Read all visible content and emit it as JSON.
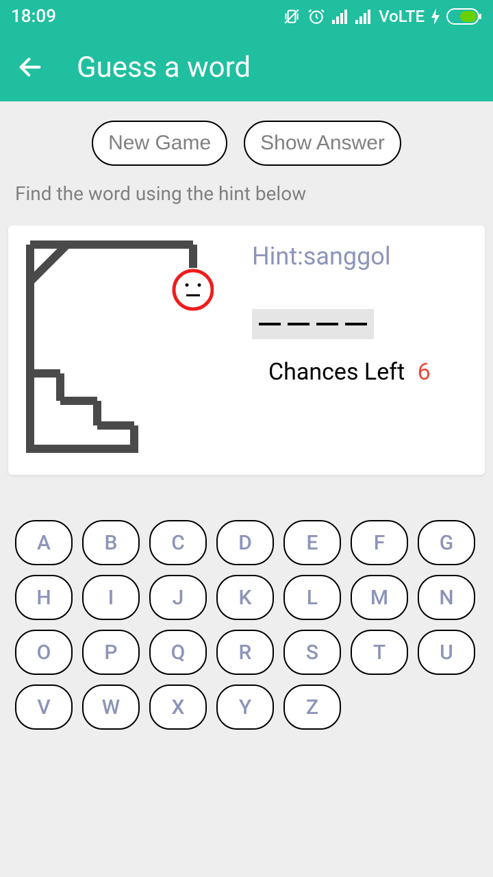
{
  "status": {
    "time": "18:09",
    "volte": "VoLTE"
  },
  "appbar": {
    "title": "Guess a word"
  },
  "actions": {
    "new_game": "New Game",
    "show_answer": "Show Answer"
  },
  "instruction": "Find the word using the hint below",
  "game": {
    "hint_label": "Hint:",
    "hint_value": "sanggol",
    "word_length": 4,
    "chances_label": "Chances Left",
    "chances_value": "6"
  },
  "keyboard": {
    "rows": [
      [
        "A",
        "B",
        "C",
        "D",
        "E",
        "F",
        "G"
      ],
      [
        "H",
        "I",
        "J",
        "K",
        "L",
        "M",
        "N"
      ],
      [
        "O",
        "P",
        "Q",
        "R",
        "S",
        "T",
        "U"
      ],
      [
        "V",
        "W",
        "X",
        "Y",
        "Z"
      ]
    ]
  }
}
